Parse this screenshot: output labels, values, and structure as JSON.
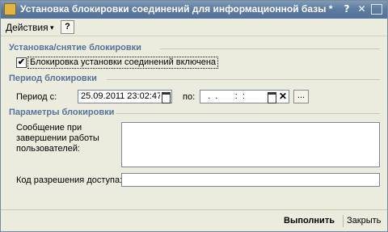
{
  "window": {
    "title": "Установка блокировки соединений для информационной базы *",
    "help_glyph": "?",
    "close_glyph": "✕"
  },
  "toolbar": {
    "actions_label": "Действия",
    "actions_arrow": "▾",
    "help_label": "?"
  },
  "sections": {
    "lock": "Установка/снятие блокировки",
    "period": "Период блокировки",
    "params": "Параметры блокировки"
  },
  "lock": {
    "checkbox_checked": true,
    "checkbox_glyph": "✔",
    "checkbox_label": "Блокировка установки соединений включена"
  },
  "period": {
    "from_label": "Период с:",
    "from_value": "25.09.2011 23:02:47",
    "to_label": "по:",
    "to_value": "  .  .       :  :  ",
    "clear_glyph": "✕",
    "dots_label": "..."
  },
  "params": {
    "message_label": "Сообщение при завершении работы пользователей:",
    "message_value": "",
    "access_code_label": "Код разрешения доступа:",
    "access_code_value": ""
  },
  "buttons": {
    "run": "Выполнить",
    "close": "Закрыть"
  }
}
